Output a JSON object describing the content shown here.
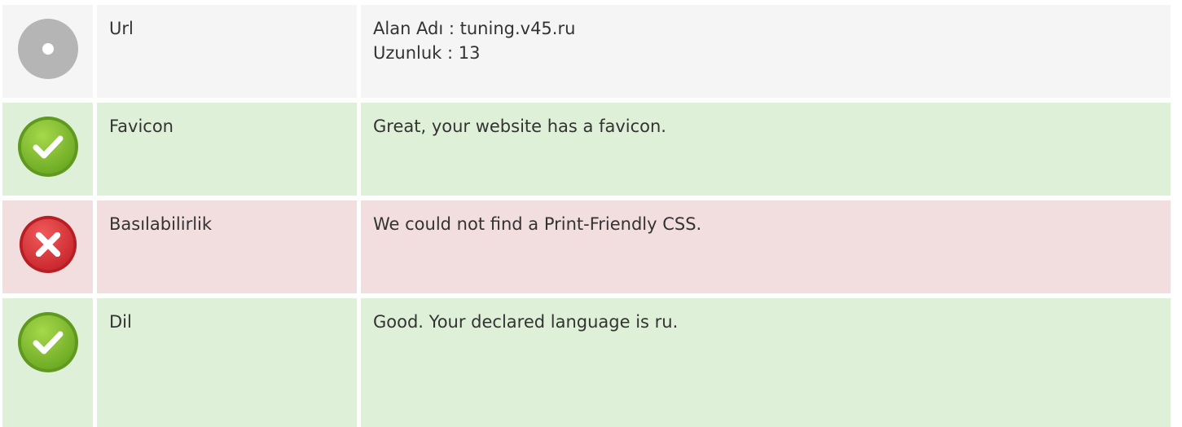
{
  "rows": [
    {
      "status": "neutral",
      "icon": "neutral-dot-icon",
      "label": "Url",
      "lines": [
        "Alan Adı : tuning.v45.ru",
        "Uzunluk : 13"
      ]
    },
    {
      "status": "pass",
      "icon": "check-icon",
      "label": "Favicon",
      "lines": [
        "Great, your website has a favicon."
      ]
    },
    {
      "status": "fail",
      "icon": "cross-icon",
      "label": "Basılabilirlik",
      "lines": [
        "We could not find a Print-Friendly CSS."
      ]
    },
    {
      "status": "pass",
      "icon": "check-icon",
      "label": "Dil",
      "lines": [
        "Good. Your declared language is ru."
      ]
    }
  ],
  "colors": {
    "neutral_bg": "#f5f5f5",
    "pass_bg": "#dff0d8",
    "fail_bg": "#f2dede",
    "pass_icon": "#7cb82f",
    "fail_icon": "#d9363e",
    "neutral_icon": "#b5b5b5"
  }
}
